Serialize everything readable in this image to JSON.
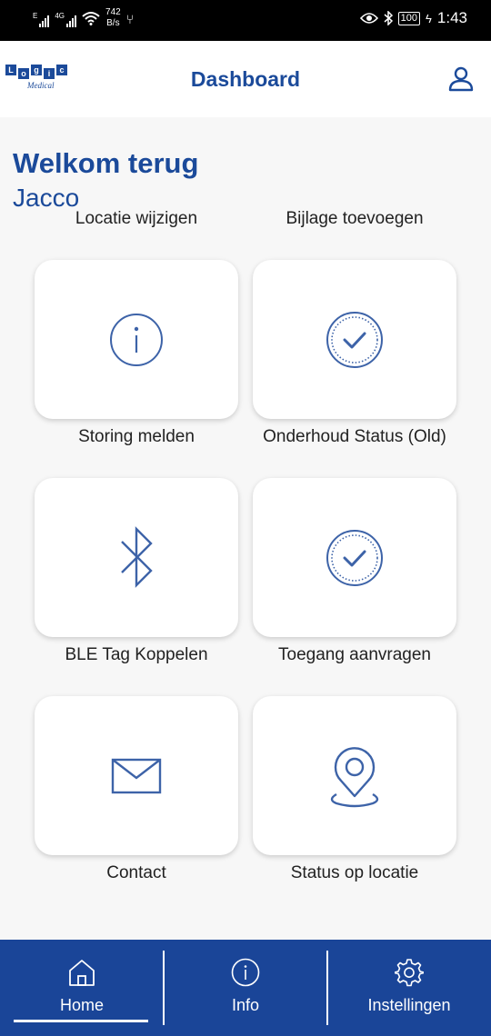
{
  "status_bar": {
    "net_speed": "742",
    "net_unit": "B/s",
    "battery": "100",
    "time": "1:43",
    "sig1_label": "E",
    "sig2_label": "4G"
  },
  "app_bar": {
    "title": "Dashboard",
    "logo_sub": "Medical",
    "logo_letters": [
      "L",
      "o",
      "g",
      "i",
      "c"
    ]
  },
  "greeting": {
    "welcome": "Welkom terug",
    "name": "Jacco"
  },
  "tiles": [
    {
      "top_label": "Locatie wijzigen"
    },
    {
      "top_label": "Bijlage toevoegen"
    },
    {
      "label": "Storing melden",
      "icon": "info-circle-icon"
    },
    {
      "label": "Onderhoud Status (Old)",
      "icon": "check-badge-icon"
    },
    {
      "label": "BLE Tag Koppelen",
      "icon": "bluetooth-icon"
    },
    {
      "label": "Toegang aanvragen",
      "icon": "check-badge-icon"
    },
    {
      "label": "Contact",
      "icon": "mail-icon"
    },
    {
      "label": "Status op locatie",
      "icon": "location-pin-icon"
    }
  ],
  "bottom_nav": {
    "home": "Home",
    "info": "Info",
    "settings": "Instellingen",
    "active": "Home"
  },
  "colors": {
    "primary": "#1b4a9a",
    "nav_bg": "#1a4598",
    "icon_stroke": "#3d63a8"
  }
}
